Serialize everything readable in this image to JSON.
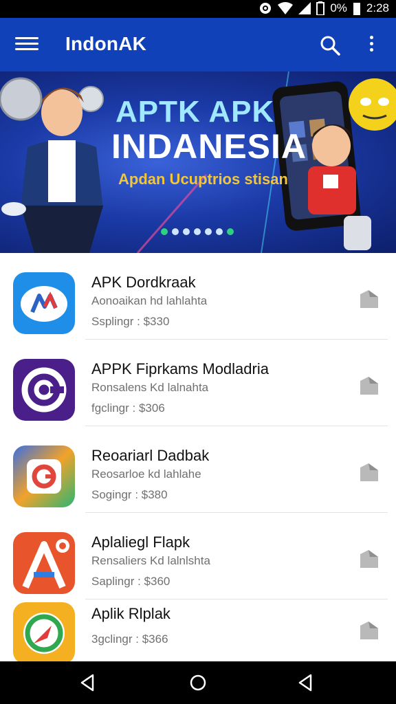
{
  "status_bar": {
    "battery_text": "0%",
    "time": "2:28"
  },
  "app_bar": {
    "title": "IndonAK"
  },
  "banner": {
    "title_line1": "APTK APK",
    "title_line2": "INDANESIA",
    "subtitle": "Apdan Ucuptrios stisan",
    "dot_count": 7,
    "active_dot": 0
  },
  "apps": [
    {
      "name": "APK Dordkraak",
      "desc": "Aonoaikan hd lahlahta",
      "price": "Ssplingr : $330",
      "icon": "chart-icon"
    },
    {
      "name": "APPK Fiprkams Modladria",
      "desc": "Ronsalens Kd lalnahta",
      "price": "fgclingr : $306",
      "icon": "at-sign-icon"
    },
    {
      "name": "Reoariarl Dadbak",
      "desc": "Reosarloe kd lahlahe",
      "price": "Sogingr : $380",
      "icon": "g-logo-icon"
    },
    {
      "name": "Aplaliegl Flapk",
      "desc": "Rensaliers Kd lalnlshta",
      "price": "Saplingr : $360",
      "icon": "a-logo-icon"
    },
    {
      "name": "Aplik Rlplak",
      "desc": "",
      "price": "3gclingr : $366",
      "icon": "compass-icon"
    }
  ],
  "colors": {
    "app_bar": "#1041b8",
    "status_bar": "#000000",
    "accent_dot": "#2fd07f"
  }
}
